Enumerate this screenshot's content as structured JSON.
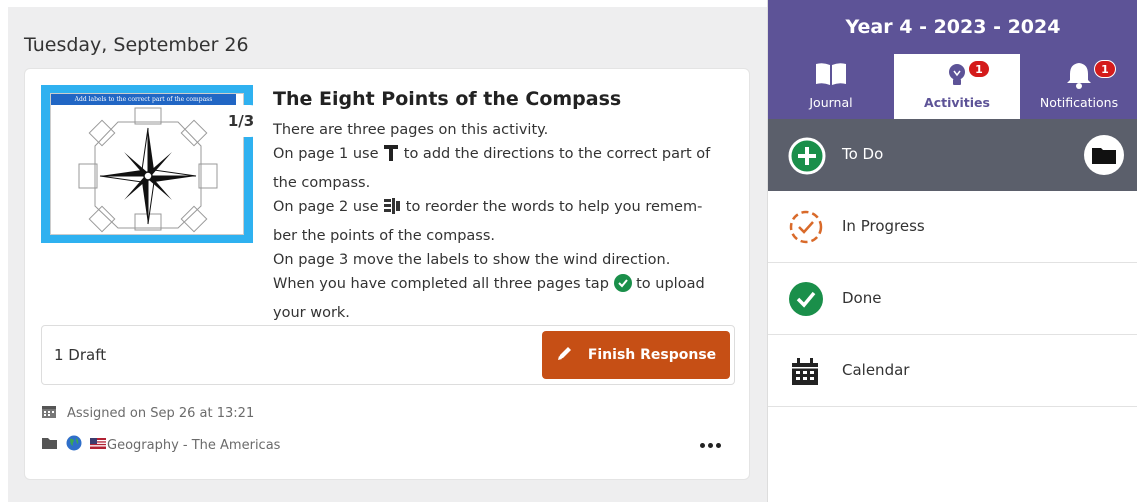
{
  "date_heading": "Tuesday, September 26",
  "activity": {
    "thumbnail_banner": "Add labels to the correct part of the compass",
    "page_indicator": "1/3",
    "title": "The Eight Points of the Compass",
    "lines": {
      "l1": "There are three pages on this activity.",
      "l2a": "On page 1 use",
      "l2b": "to add the directions to the correct part of",
      "l3": "the compass.",
      "l4a": "On page 2 use",
      "l4b": "to reorder the words to help you remem-",
      "l5": "ber the points of the compass.",
      "l6": "On page 3 move the labels to show the wind direction.",
      "l7a": "When you have completed all three pages tap",
      "l7b": "to upload",
      "l8": "your work."
    },
    "draft_label": "1 Draft",
    "finish_button": "Finish Response",
    "assigned": "Assigned on Sep 26 at 13:21",
    "folder": "Geography - The Americas",
    "flag_emoji": "🇺🇸"
  },
  "sidebar": {
    "year_title": "Year 4 - 2023 - 2024",
    "tabs": {
      "journal": "Journal",
      "activities": "Activities",
      "notifications": "Notifications"
    },
    "activities_badge": "1",
    "notifications_badge": "1",
    "todo": "To Do",
    "in_progress": "In Progress",
    "done": "Done",
    "calendar": "Calendar"
  },
  "colors": {
    "brand_purple": "#5d5397",
    "finish_orange": "#c64f15",
    "done_green": "#1a8f4a",
    "progress_orange": "#d96a2a",
    "badge_red": "#d41b1b"
  }
}
